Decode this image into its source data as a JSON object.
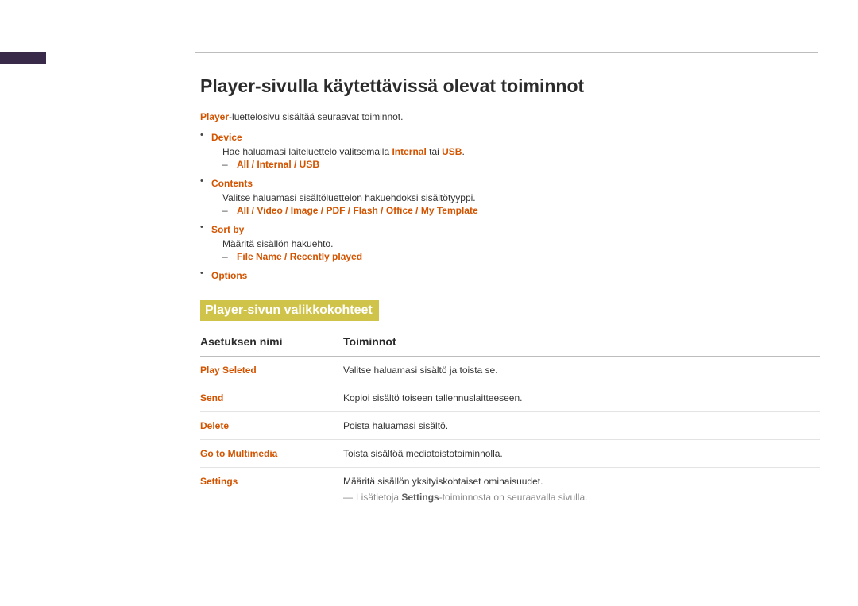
{
  "heading": "Player-sivulla käytettävissä olevat toiminnot",
  "intro": {
    "prefix_kw": "Player",
    "rest": "-luettelosivu sisältää seuraavat toiminnot."
  },
  "bullets": {
    "device": {
      "label": "Device",
      "desc_pre": "Hae haluamasi laiteluettelo valitsemalla ",
      "desc_kw1": "Internal",
      "desc_mid": " tai ",
      "desc_kw2": "USB",
      "desc_end": ".",
      "sub": "All / Internal / USB"
    },
    "contents": {
      "label": "Contents",
      "desc": "Valitse haluamasi sisältöluettelon hakuehdoksi sisältötyyppi.",
      "sub": "All / Video / Image / PDF / Flash / Office / My Template"
    },
    "sortby": {
      "label": "Sort by",
      "desc": "Määritä sisällön hakuehto.",
      "sub": "File Name / Recently played"
    },
    "options": {
      "label": "Options"
    }
  },
  "sub_heading": "Player-sivun valikkokohteet",
  "table": {
    "headers": {
      "name": "Asetuksen nimi",
      "fn": "Toiminnot"
    },
    "rows": [
      {
        "name": "Play Seleted",
        "fn": "Valitse haluamasi sisältö ja toista se."
      },
      {
        "name": "Send",
        "fn": "Kopioi sisältö toiseen tallennuslaitteeseen."
      },
      {
        "name": "Delete",
        "fn": "Poista haluamasi sisältö."
      },
      {
        "name": "Go to Multimedia",
        "fn": "Toista sisältöä mediatoistotoiminnolla."
      },
      {
        "name": "Settings",
        "fn": "Määritä sisällön yksityiskohtaiset ominaisuudet."
      }
    ],
    "note": {
      "pre": "Lisätietoja ",
      "kw": "Settings",
      "post": "-toiminnosta on seuraavalla sivulla."
    }
  }
}
